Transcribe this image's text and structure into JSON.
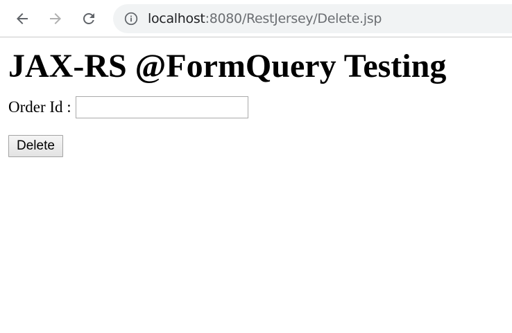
{
  "browser": {
    "url_host": "localhost",
    "url_path": ":8080/RestJersey/Delete.jsp",
    "icons": {
      "back": "arrow-left-icon",
      "forward": "arrow-right-icon",
      "reload": "reload-icon",
      "site_info": "info-icon"
    },
    "colors": {
      "omnibox_bg": "#f1f3f4",
      "forward_disabled": "#b0b0b0"
    }
  },
  "page": {
    "heading": "JAX-RS @FormQuery Testing",
    "form": {
      "order_id_label": "Order Id :",
      "order_id_value": "",
      "delete_label": "Delete"
    }
  }
}
